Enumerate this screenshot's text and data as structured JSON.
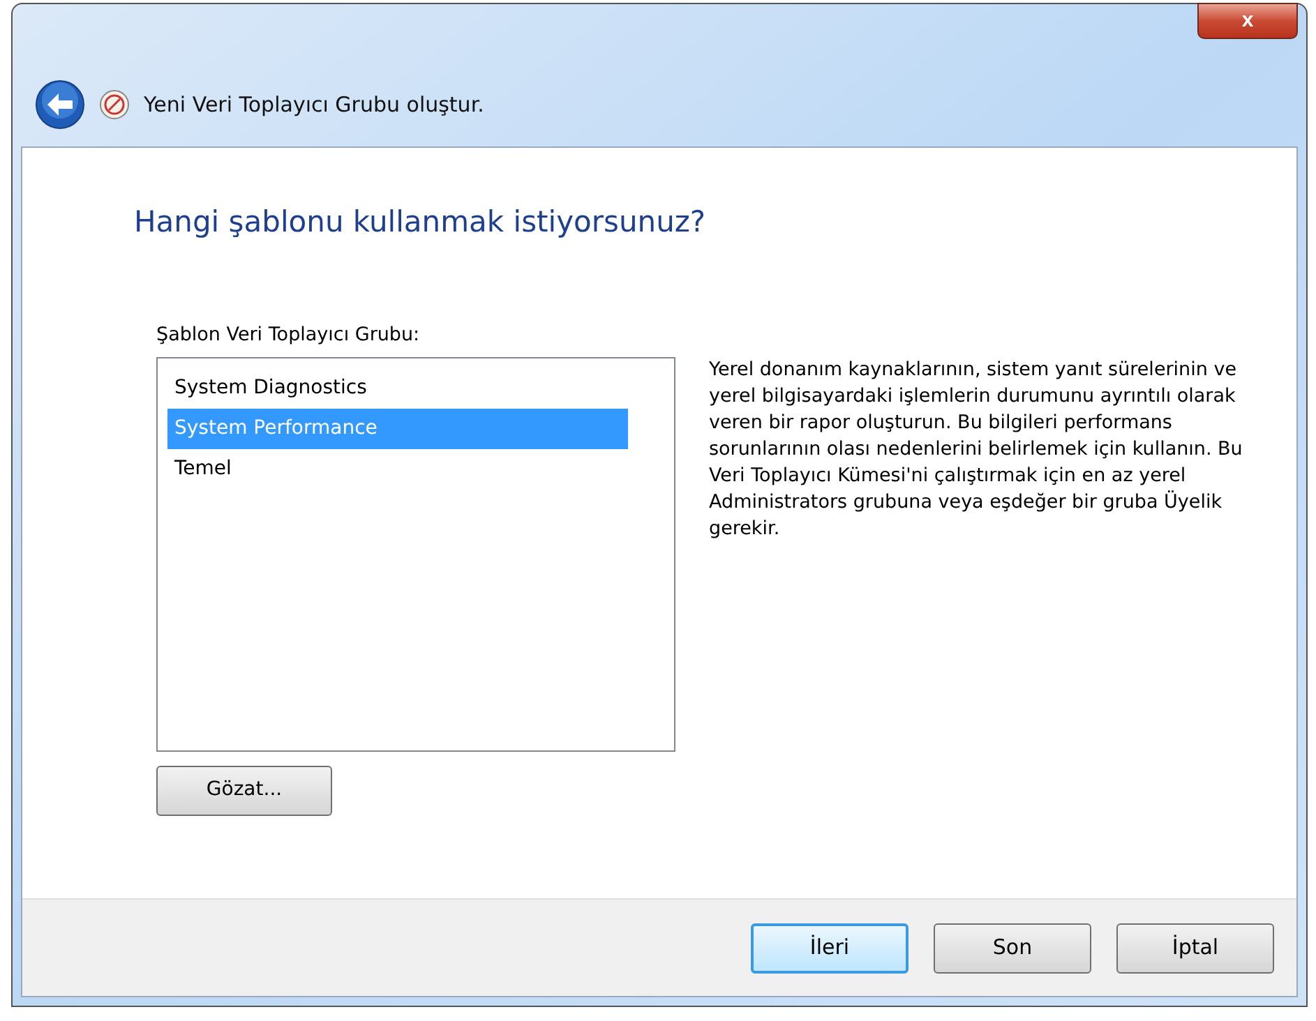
{
  "window": {
    "title": "Yeni Veri Toplayıcı Grubu oluştur.",
    "close": "x"
  },
  "heading": "Hangi şablonu kullanmak istiyorsunuz?",
  "template_list": {
    "label": "Şablon Veri Toplayıcı Grubu:",
    "items": [
      {
        "label": "System Diagnostics",
        "selected": false
      },
      {
        "label": "System Performance",
        "selected": true
      },
      {
        "label": "Temel",
        "selected": false
      }
    ]
  },
  "browse_button": "Gözat...",
  "description": "Yerel donanım kaynaklarının, sistem yanıt sürelerinin ve yerel bilgisayardaki işlemlerin durumunu ayrıntılı olarak veren bir rapor oluşturun.  Bu bilgileri performans sorunlarının olası nedenlerini belirlemek için kullanın. Bu Veri Toplayıcı Kümesi'ni çalıştırmak için en az yerel Administrators grubuna veya eşdeğer bir gruba Üyelik gerekir.",
  "buttons": [
    {
      "label": "İleri",
      "focused": true
    },
    {
      "label": "Son",
      "focused": false
    },
    {
      "label": "İptal",
      "focused": false
    }
  ]
}
